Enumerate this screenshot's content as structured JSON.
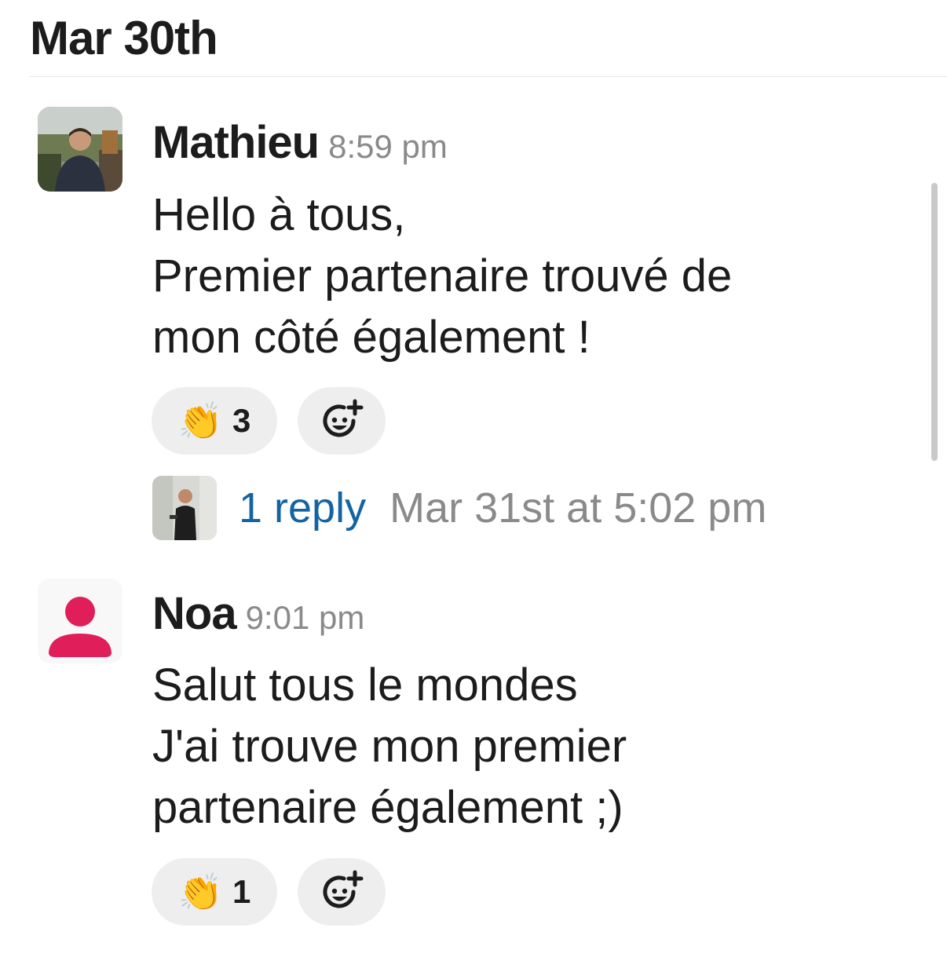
{
  "date_header": "Mar 30th",
  "messages": [
    {
      "author": "Mathieu",
      "time": "8:59 pm",
      "lines": [
        "Hello à tous,",
        "Premier partenaire trouvé de",
        "mon côté également !"
      ],
      "reaction": {
        "emoji": "👏",
        "count": "3"
      },
      "thread": {
        "reply_label": "1 reply",
        "reply_time": "Mar 31st at 5:02 pm"
      }
    },
    {
      "author": "Noa",
      "time": "9:01 pm",
      "lines": [
        "Salut tous le mondes",
        "J'ai trouve mon premier",
        "partenaire également ;)"
      ],
      "reaction": {
        "emoji": "👏",
        "count": "1"
      }
    }
  ],
  "icons": {
    "add_reaction": "add-reaction-icon",
    "clap": "clapping-hands-icon",
    "default_avatar": "person-icon"
  },
  "colors": {
    "link": "#1264a3",
    "default_avatar": "#e01e5a",
    "reaction_bg": "#eeeeee"
  }
}
